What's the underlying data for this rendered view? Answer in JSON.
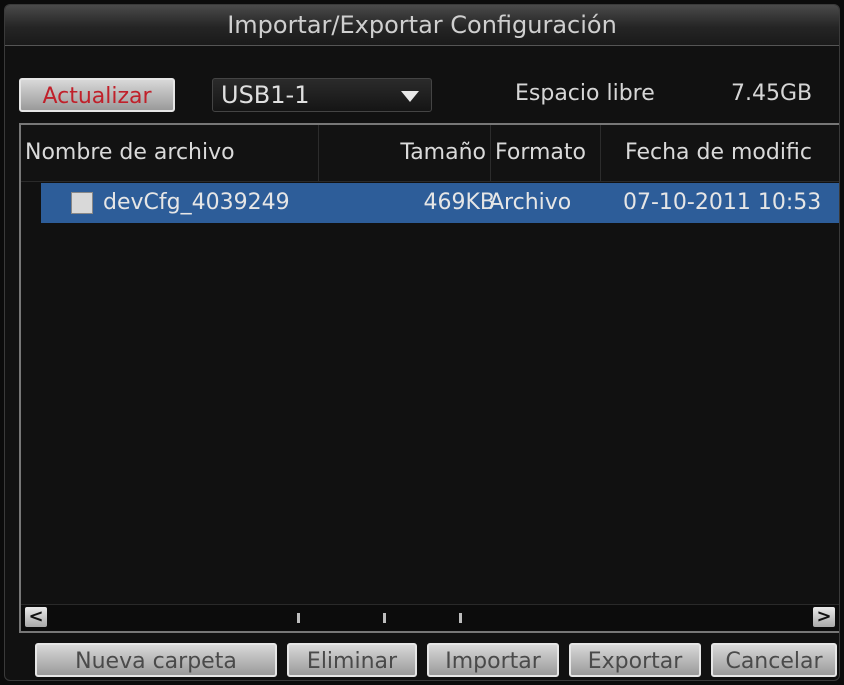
{
  "window": {
    "title": "Importar/Exportar Configuración"
  },
  "toolbar": {
    "refresh_label": "Actualizar",
    "device_selected": "USB1-1",
    "free_space_label": "Espacio libre",
    "free_space_value": "7.45GB"
  },
  "table": {
    "columns": [
      "Nombre de archivo",
      "Tamaño",
      "Formato",
      "Fecha de modific"
    ],
    "rows": [
      {
        "name": "devCfg_4039249",
        "size": "469KB",
        "format": "Archivo",
        "date": "07-10-2011 10:53",
        "selected": true
      }
    ]
  },
  "scroll": {
    "left_arrow": "<",
    "right_arrow": ">"
  },
  "buttons": {
    "new_folder": "Nueva carpeta",
    "delete": "Eliminar",
    "import": "Importar",
    "export": "Exportar",
    "cancel": "Cancelar"
  },
  "colors": {
    "selection": "#2d5d99",
    "refresh_text": "#c0202a"
  }
}
